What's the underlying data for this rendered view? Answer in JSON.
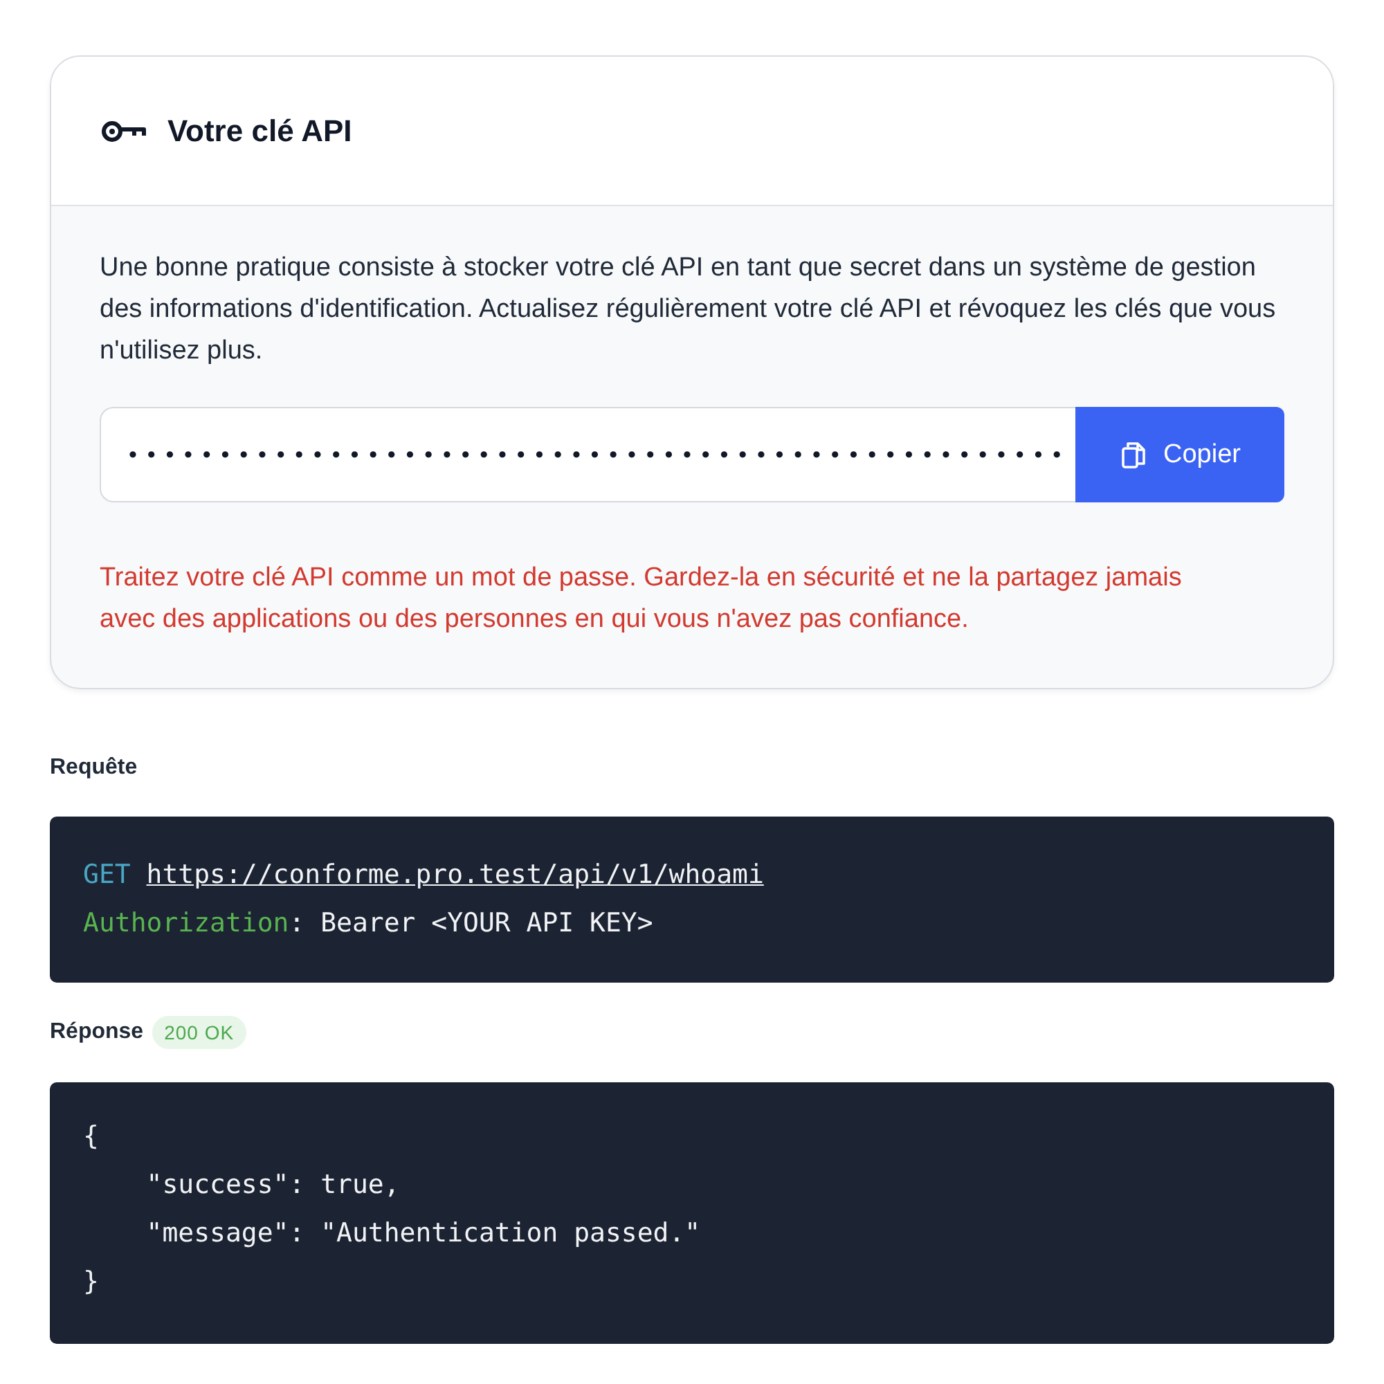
{
  "card": {
    "title": "Votre clé API",
    "description": "Une bonne pratique consiste à stocker votre clé API en tant que secret dans un système de gestion des informations d'identification. Actualisez régulièrement votre clé API et révoquez les clés que vous n'utilisez plus.",
    "key_field": {
      "value": "•••••••••••••••••••••••••••••••••••••••••••••••••••"
    },
    "copy_button": "Copier",
    "warning": "Traitez votre clé API comme un mot de passe. Gardez-la en sécurité et ne la partagez jamais avec des applications ou des personnes en qui vous n'avez pas confiance."
  },
  "request": {
    "label": "Requête",
    "lines": [
      [
        {
          "kind": "method",
          "text": "GET"
        },
        {
          "kind": "link",
          "text": "https://conforme.pro.test/api/v1/whoami"
        }
      ],
      [
        {
          "kind": "header",
          "text": "Authorization"
        },
        {
          "kind": "plain",
          "text": ": Bearer <YOUR API KEY>"
        }
      ]
    ]
  },
  "response": {
    "label": "Réponse",
    "status": "200 OK",
    "lines": [
      "{",
      "    \"success\": true,",
      "    \"message\": \"Authentication passed.\"",
      "}"
    ]
  }
}
